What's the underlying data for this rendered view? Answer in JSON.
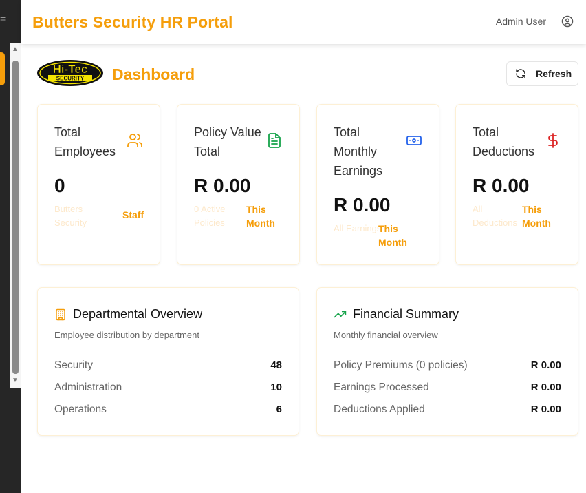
{
  "sidebar": {
    "mark": "="
  },
  "scrollbar": {
    "up": "▲",
    "down": "▼"
  },
  "header": {
    "title": "Butters Security HR Portal",
    "user": "Admin User"
  },
  "page": {
    "logo_text": "Hi-Tec",
    "logo_subtext": "SECURITY",
    "title": "Dashboard",
    "refresh_label": "Refresh"
  },
  "stats": [
    {
      "title": "Total Employees",
      "icon": "users-icon",
      "value": "0",
      "sub": "Butters Security",
      "tag": "Staff",
      "color": "#f59e0b"
    },
    {
      "title": "Policy Value Total",
      "icon": "file-text-icon",
      "value": "R 0.00",
      "sub": "0 Active Policies",
      "tag": "This Month",
      "color": "#16a34a"
    },
    {
      "title": "Total Monthly Earnings",
      "icon": "banknote-icon",
      "value": "R 0.00",
      "sub": "All Earnings",
      "tag": "This Month",
      "color": "#2563eb"
    },
    {
      "title": "Total Deductions",
      "icon": "dollar-icon",
      "value": "R 0.00",
      "sub": "All Deductions",
      "tag": "This Month",
      "color": "#dc2626"
    }
  ],
  "departments": {
    "title": "Departmental Overview",
    "description": "Employee distribution by department",
    "icon": "building-icon",
    "rows": [
      {
        "label": "Security",
        "value": "48"
      },
      {
        "label": "Administration",
        "value": "10"
      },
      {
        "label": "Operations",
        "value": "6"
      }
    ]
  },
  "financial": {
    "title": "Financial Summary",
    "description": "Monthly financial overview",
    "icon": "trending-up-icon",
    "rows": [
      {
        "label": "Policy Premiums (0 policies)",
        "value": "R 0.00"
      },
      {
        "label": "Earnings Processed",
        "value": "R 0.00"
      },
      {
        "label": "Deductions Applied",
        "value": "R 0.00"
      }
    ]
  },
  "colors": {
    "accent": "#f59e0b",
    "sidebar": "#262626",
    "green": "#16a34a",
    "blue": "#2563eb",
    "red": "#dc2626"
  }
}
